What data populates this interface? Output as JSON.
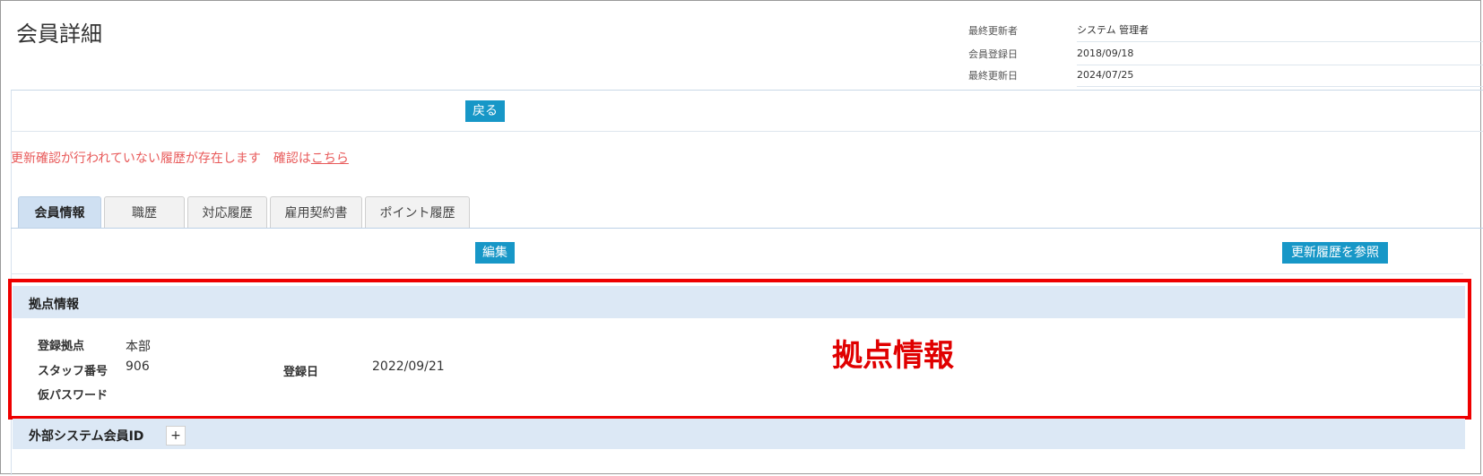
{
  "header": {
    "title": "会員詳細"
  },
  "meta": [
    {
      "label": "最終更新者",
      "value": "システム 管理者"
    },
    {
      "label": "会員登録日",
      "value": "2018/09/18"
    },
    {
      "label": "最終更新日",
      "value": "2024/07/25"
    }
  ],
  "actions": {
    "back_label": "戻る",
    "edit_label": "編集",
    "history_label": "更新履歴を参照"
  },
  "notice": {
    "text": "更新確認が行われていない履歴が存在します　確認は",
    "link": "こちら"
  },
  "tabs": [
    {
      "label": "会員情報",
      "active": true
    },
    {
      "label": "職歴"
    },
    {
      "label": "対応履歴"
    },
    {
      "label": "雇用契約書"
    },
    {
      "label": "ポイント履歴"
    }
  ],
  "base_info": {
    "title": "拠点情報",
    "fields": {
      "branch_label": "登録拠点",
      "branch_value": "本部",
      "staff_no_label": "スタッフ番号",
      "staff_no_value": "906",
      "reg_date_label": "登録日",
      "reg_date_value": "2022/09/21",
      "temp_password_label": "仮パスワード",
      "temp_password_value": ""
    }
  },
  "annotation": {
    "label": "拠点情報",
    "color": "#ee0000"
  },
  "external": {
    "title": "外部システム会員ID",
    "add_label": "+"
  },
  "colors": {
    "accent": "#1797c7",
    "notice": "#e85a5a",
    "section_bg": "#dce8f5",
    "tab_active_bg": "#cfe0f2"
  }
}
